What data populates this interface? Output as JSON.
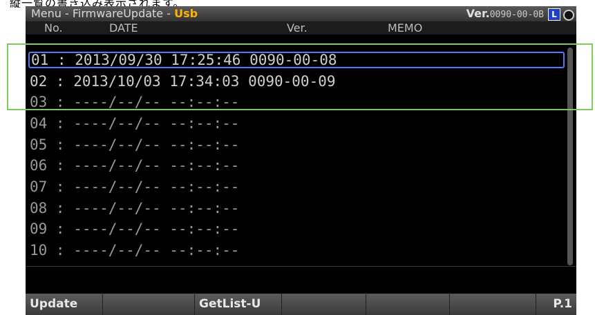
{
  "caption_text": "縦一覧の書き込み表示されます。",
  "title": {
    "prefix": "Menu - FirmwareUpdate - ",
    "mode": "Usb",
    "ver_label": "Ver.",
    "ver_value": "0090-00-0B",
    "badge": "L"
  },
  "columns": {
    "no": "No.",
    "date": "DATE",
    "ver": "Ver.",
    "memo": "MEMO"
  },
  "rows": [
    "01 : 2013/09/30 17:25:46 0090-00-08",
    "02 : 2013/10/03 17:34:03 0090-00-09",
    "03 : ----/--/-- --:--:--",
    "04 : ----/--/-- --:--:--",
    "05 : ----/--/-- --:--:--",
    "06 : ----/--/-- --:--:--",
    "07 : ----/--/-- --:--:--",
    "08 : ----/--/-- --:--:--",
    "09 : ----/--/-- --:--:--",
    "10 : ----/--/-- --:--:--"
  ],
  "selected_row": 1,
  "softkeys": {
    "k1": "Update",
    "k2": "",
    "k3": "GetList-U",
    "k4": "",
    "k5": "",
    "k6": "",
    "page": "P.1"
  },
  "colors": {
    "accent": "#ffb400",
    "selection": "#4a7dff",
    "annotation": "#7cc85a",
    "badge": "#1e40c8"
  }
}
